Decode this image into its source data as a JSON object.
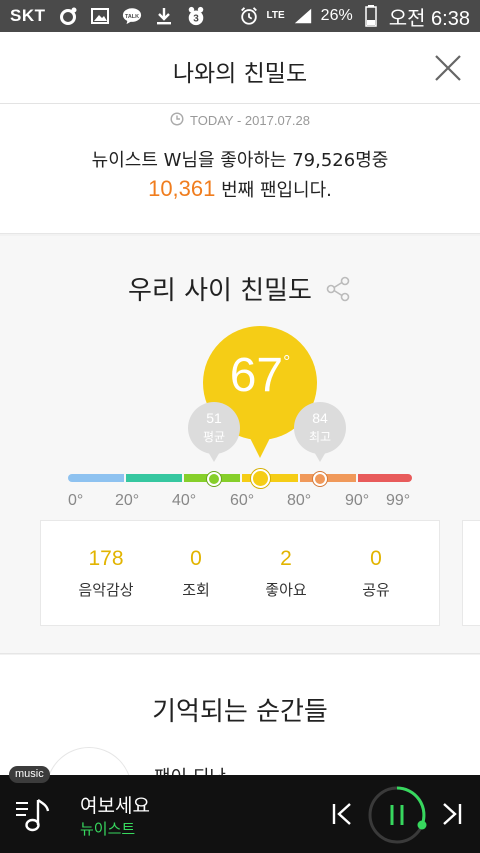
{
  "status_bar": {
    "carrier": "SKT",
    "network": "LTE",
    "battery": "26%",
    "time": "오전 6:38"
  },
  "header": {
    "title": "나와의 친밀도"
  },
  "today": {
    "label": "TODAY - 2017.07.28",
    "fan_prefix": "뉴이스트 W님을 좋아하는 79,526명중",
    "fan_rank": "10,361",
    "fan_suffix": " 번째 팬입니다."
  },
  "intimacy": {
    "title": "우리 사이 친밀도",
    "my_score": "67",
    "degree": "°",
    "average": {
      "value": "51",
      "label": "평균"
    },
    "highest": {
      "value": "84",
      "label": "최고"
    },
    "ticks": [
      "0°",
      "20°",
      "40°",
      "60°",
      "80°",
      "90°",
      "99°"
    ],
    "score_fraction": 0.67,
    "colors": {
      "accent": "#f5cd16",
      "orange": "#f07d1e",
      "green": "#86cf2a"
    },
    "stats": [
      {
        "value": "178",
        "label": "음악감상"
      },
      {
        "value": "0",
        "label": "조회"
      },
      {
        "value": "2",
        "label": "좋아요"
      },
      {
        "value": "0",
        "label": "공유"
      }
    ]
  },
  "moments": {
    "title": "기억되는 순간들",
    "partial_text": "팬이 되난"
  },
  "player": {
    "badge": "music",
    "song": "여보세요",
    "artist": "뉴이스트"
  }
}
